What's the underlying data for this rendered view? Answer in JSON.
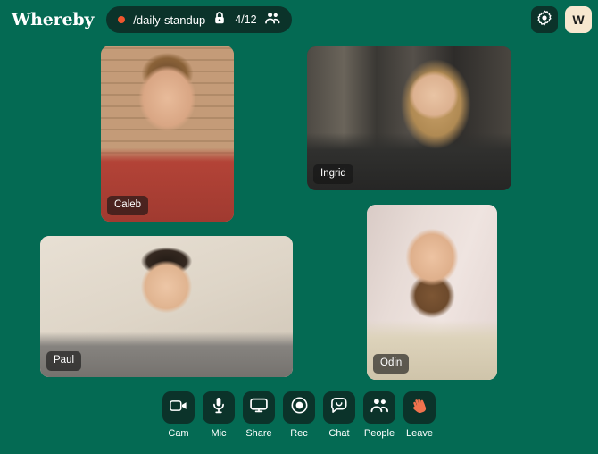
{
  "app": {
    "brand": "Whereby",
    "background_color": "#046a53",
    "panel_color": "#0b332a",
    "accent_color": "#f0562e",
    "avatar_color": "#f7e7cf"
  },
  "header": {
    "room": {
      "status_dot": "recording-dot",
      "name": "/daily-standup",
      "lock_icon": "lock-icon",
      "participant_count": "4/12",
      "people_icon": "people-icon"
    },
    "settings": {
      "icon": "gear-icon",
      "label": "Settings"
    },
    "avatar": {
      "icon": "avatar",
      "initial": "W"
    }
  },
  "stage": {
    "tiles": [
      {
        "id": "caleb",
        "name": "Caleb"
      },
      {
        "id": "ingrid",
        "name": "Ingrid"
      },
      {
        "id": "paul",
        "name": "Paul"
      },
      {
        "id": "odin",
        "name": "Odin"
      }
    ]
  },
  "toolbar": {
    "items": [
      {
        "label": "Cam",
        "icon": "camera-icon"
      },
      {
        "label": "Mic",
        "icon": "microphone-icon"
      },
      {
        "label": "Share",
        "icon": "screen-share-icon"
      },
      {
        "label": "Rec",
        "icon": "record-icon"
      },
      {
        "label": "Chat",
        "icon": "chat-bubble-icon"
      },
      {
        "label": "People",
        "icon": "people-icon"
      },
      {
        "label": "Leave",
        "icon": "waving-hand-icon"
      }
    ]
  }
}
